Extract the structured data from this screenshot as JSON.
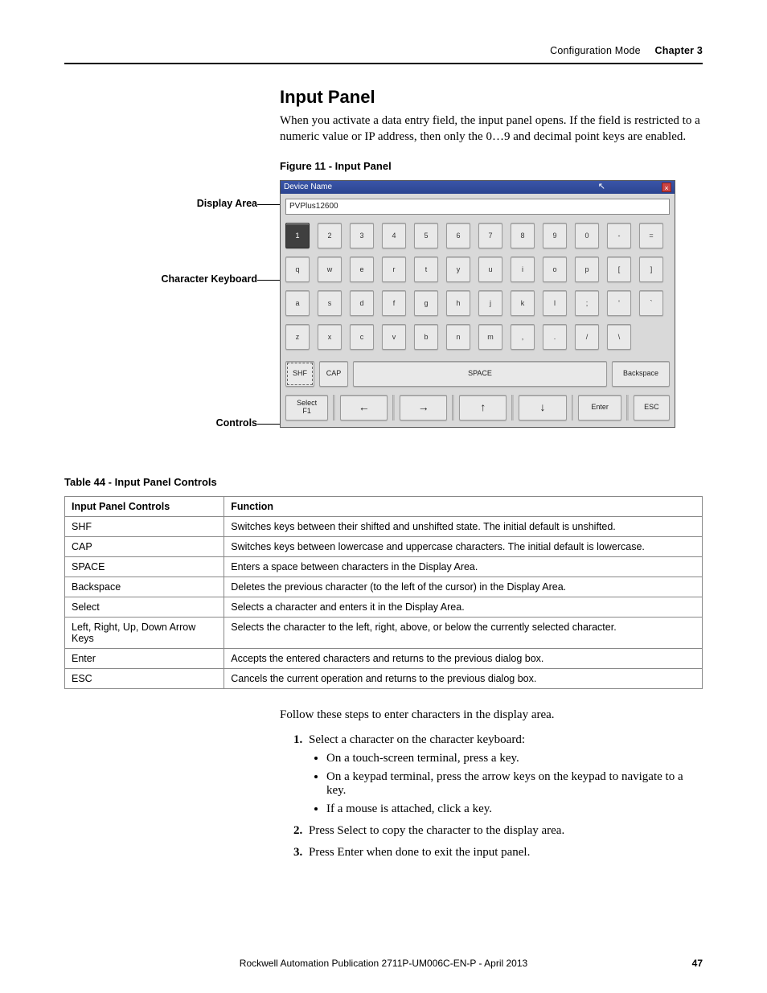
{
  "header": {
    "section": "Configuration Mode",
    "chapter": "Chapter 3"
  },
  "section_title": "Input Panel",
  "intro": "When you activate a data entry field, the input panel opens. If the field is restricted to a numeric value or IP address, then only the 0…9 and decimal point keys are enabled.",
  "figure_caption": "Figure 11 - Input Panel",
  "callouts": {
    "display_area": "Display Area",
    "character_keyboard": "Character Keyboard",
    "controls": "Controls"
  },
  "panel": {
    "title": "Device Name",
    "display_value": "PVPlus12600",
    "rows": [
      [
        "1",
        "2",
        "3",
        "4",
        "5",
        "6",
        "7",
        "8",
        "9",
        "0",
        "-",
        "="
      ],
      [
        "q",
        "w",
        "e",
        "r",
        "t",
        "y",
        "u",
        "i",
        "o",
        "p",
        "[",
        "]"
      ],
      [
        "a",
        "s",
        "d",
        "f",
        "g",
        "h",
        "j",
        "k",
        "l",
        ";",
        "'",
        "`"
      ],
      [
        "z",
        "x",
        "c",
        "v",
        "b",
        "n",
        "m",
        ",",
        ".",
        "/",
        "\\"
      ]
    ],
    "ctrl": {
      "shf": "SHF",
      "cap": "CAP",
      "space": "SPACE",
      "backspace": "Backspace",
      "select": "Select\nF1",
      "left": "←",
      "right": "→",
      "up": "↑",
      "down": "↓",
      "enter": "Enter",
      "esc": "ESC"
    }
  },
  "table_caption": "Table 44 - Input Panel Controls",
  "table": {
    "headers": [
      "Input Panel Controls",
      "Function"
    ],
    "rows": [
      [
        "SHF",
        "Switches keys between their shifted and unshifted state. The initial default is unshifted."
      ],
      [
        "CAP",
        "Switches keys between lowercase and uppercase characters. The initial default is lowercase."
      ],
      [
        "SPACE",
        "Enters a space between characters in the Display Area."
      ],
      [
        "Backspace",
        "Deletes the previous character (to the left of the cursor) in the Display Area."
      ],
      [
        "Select",
        "Selects a character and enters it in the Display Area."
      ],
      [
        "Left, Right, Up, Down Arrow Keys",
        "Selects the character to the left, right, above, or below the currently selected character."
      ],
      [
        "Enter",
        "Accepts the entered characters and returns to the previous dialog box."
      ],
      [
        "ESC",
        "Cancels the current operation and returns to the previous dialog box."
      ]
    ]
  },
  "follow_text": "Follow these steps to enter characters in the display area.",
  "steps": {
    "s1": "Select a character on the character keyboard:",
    "s1a": "On a touch-screen terminal, press a key.",
    "s1b": "On a keypad terminal, press the arrow keys on the keypad to navigate to a key.",
    "s1c": "If a mouse is attached, click a key.",
    "s2": "Press Select to copy the character to the display area.",
    "s3": "Press Enter when done to exit the input panel."
  },
  "footer": {
    "pub": "Rockwell Automation Publication 2711P-UM006C-EN-P - April 2013",
    "page": "47"
  }
}
